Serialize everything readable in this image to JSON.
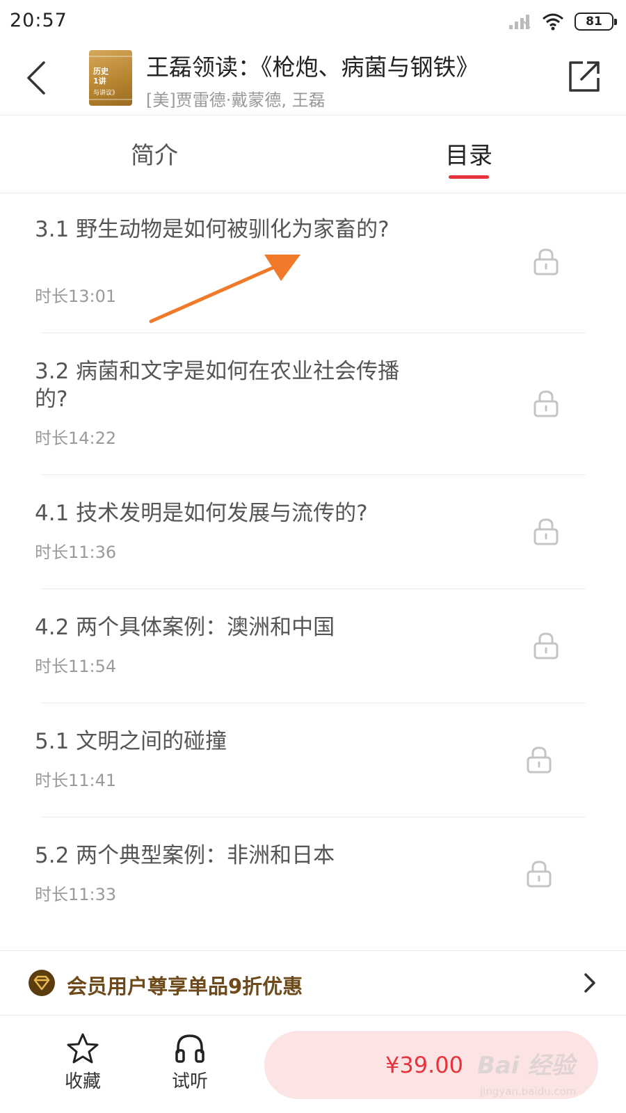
{
  "status_bar": {
    "time": "20:57",
    "battery": "81",
    "icons": [
      "signal-icon",
      "wifi-icon",
      "battery-icon"
    ]
  },
  "header": {
    "title": "王磊领读：《枪炮、病菌与钢铁》",
    "author": "[美]贾雷德·戴蒙德, 王磊",
    "cover_text": [
      "历史",
      "1讲",
      "与讲议》"
    ]
  },
  "tabs": [
    {
      "label": "简介",
      "active": false
    },
    {
      "label": "目录",
      "active": true
    }
  ],
  "accent_color": "#e8333c",
  "chapters": [
    {
      "title": "3.1 野生动物是如何被驯化为家畜的?",
      "duration": "时长13:01",
      "locked": true
    },
    {
      "title": "3.2 病菌和文字是如何在农业社会传播的?",
      "duration": "时长14:22",
      "locked": true
    },
    {
      "title": "4.1 技术发明是如何发展与流传的?",
      "duration": "时长11:36",
      "locked": true
    },
    {
      "title": "4.2 两个具体案例：澳洲和中国",
      "duration": "时长11:54",
      "locked": true
    },
    {
      "title": "5.1 文明之间的碰撞",
      "duration": "时长11:41",
      "locked": true
    },
    {
      "title": "5.2 两个典型案例：非洲和日本",
      "duration": "时长11:33",
      "locked": true
    }
  ],
  "member_banner": {
    "text": "会员用户尊享单品9折优惠"
  },
  "bottom_bar": {
    "favorite_label": "收藏",
    "trial_label": "试听",
    "price": "¥39.00"
  },
  "watermark": {
    "logo": "Bai 经验",
    "url": "jingyan.baidu.com"
  }
}
